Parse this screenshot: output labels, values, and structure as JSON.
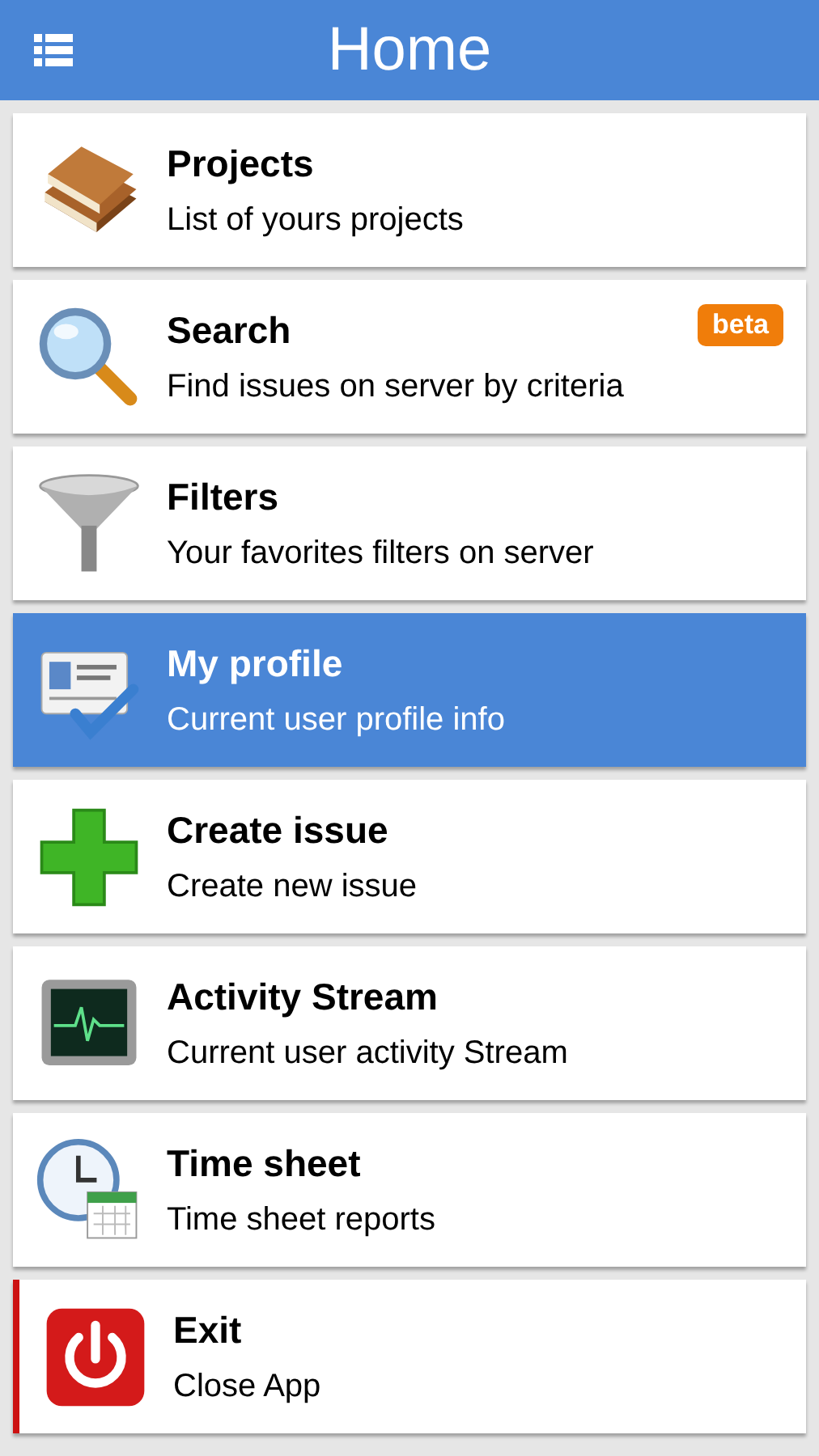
{
  "header": {
    "title": "Home"
  },
  "items": [
    {
      "title": "Projects",
      "subtitle": "List of yours projects",
      "selected": false
    },
    {
      "title": "Search",
      "subtitle": "Find issues on server by criteria",
      "selected": false,
      "badge": "beta"
    },
    {
      "title": "Filters",
      "subtitle": "Your favorites filters on server",
      "selected": false
    },
    {
      "title": "My profile",
      "subtitle": "Current user profile info",
      "selected": true
    },
    {
      "title": "Create issue",
      "subtitle": "Create new issue",
      "selected": false
    },
    {
      "title": "Activity Stream",
      "subtitle": "Current user activity Stream",
      "selected": false
    },
    {
      "title": "Time sheet",
      "subtitle": "Time sheet reports",
      "selected": false
    },
    {
      "title": "Exit",
      "subtitle": "Close App",
      "selected": false,
      "color": "#cc1111"
    }
  ]
}
